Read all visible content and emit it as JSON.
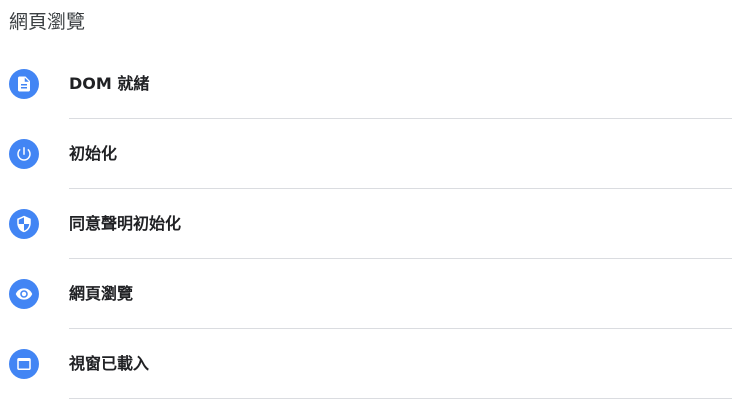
{
  "header": {
    "title": "網頁瀏覽"
  },
  "items": [
    {
      "label": "DOM 就緒",
      "icon": "document-icon"
    },
    {
      "label": "初始化",
      "icon": "power-icon"
    },
    {
      "label": "同意聲明初始化",
      "icon": "shield-icon"
    },
    {
      "label": "網頁瀏覽",
      "icon": "eye-icon"
    },
    {
      "label": "視窗已載入",
      "icon": "window-icon"
    }
  ],
  "colors": {
    "accent": "#4285f4",
    "divider": "#dadce0"
  }
}
